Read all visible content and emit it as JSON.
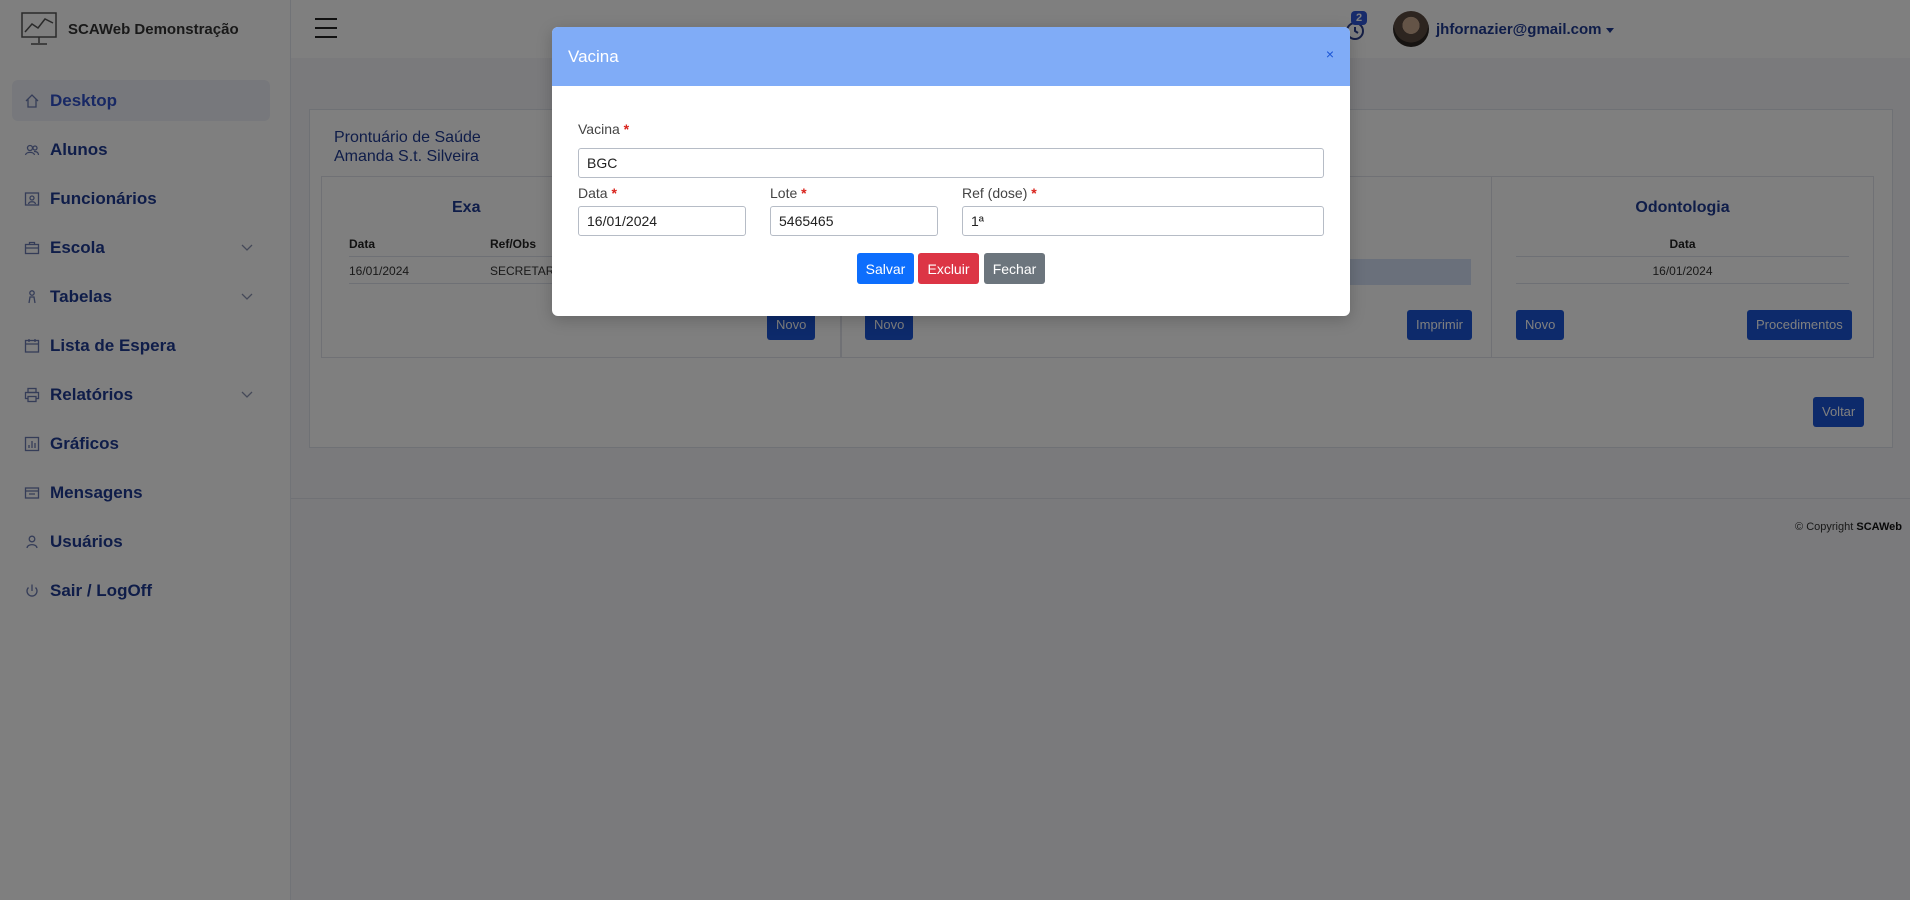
{
  "app": {
    "brand_name": "SCAWeb Demonstração"
  },
  "sidebar": {
    "items": [
      {
        "label": "Desktop",
        "icon": "home-icon",
        "active": true
      },
      {
        "label": "Alunos",
        "icon": "users-icon"
      },
      {
        "label": "Funcionários",
        "icon": "staff-icon"
      },
      {
        "label": "Escola",
        "icon": "briefcase-icon",
        "expandable": true
      },
      {
        "label": "Tabelas",
        "icon": "person-icon",
        "expandable": true
      },
      {
        "label": "Lista de Espera",
        "icon": "calendar-icon"
      },
      {
        "label": "Relatórios",
        "icon": "printer-icon",
        "expandable": true
      },
      {
        "label": "Gráficos",
        "icon": "chart-icon"
      },
      {
        "label": "Mensagens",
        "icon": "messages-icon"
      },
      {
        "label": "Usuários",
        "icon": "user-icon"
      },
      {
        "label": "Sair / LogOff",
        "icon": "power-icon"
      }
    ]
  },
  "header": {
    "notification_count": "2",
    "user_email": "jhfornazier@gmail.com"
  },
  "record": {
    "title_line1": "Prontuário de Saúde",
    "title_line2": "Amanda S.t. Silveira"
  },
  "exams_panel": {
    "title_visible": "Exa",
    "col_date": "Data",
    "col_ref": "Ref/Obs",
    "row_date": "16/01/2024",
    "row_ref": "SECRETAR",
    "new_button": "Novo"
  },
  "vaccines_panel": {
    "new_button": "Novo",
    "print_button": "Imprimir"
  },
  "dental_panel": {
    "title": "Odontologia",
    "col_date": "Data",
    "row_date": "16/01/2024",
    "new_button": "Novo",
    "procedures_button": "Procedimentos"
  },
  "back_button": "Voltar",
  "footer": {
    "copyright_prefix": "© Copyright",
    "copyright_brand": "SCAWeb"
  },
  "modal": {
    "title": "Vacina",
    "close": "×",
    "vaccine_label": "Vacina",
    "vaccine_value": "BGC",
    "date_label": "Data",
    "date_value": "16/01/2024",
    "lot_label": "Lote",
    "lot_value": "5465465",
    "ref_label": "Ref (dose)",
    "ref_value": "1ª",
    "required_mark": "*",
    "save_button": "Salvar",
    "delete_button": "Excluir",
    "close_button": "Fechar"
  },
  "colors": {
    "primary": "#1a55d6",
    "modal_header": "#80acf7",
    "save": "#0d6efd",
    "delete": "#dc3545",
    "close": "#6c757d"
  }
}
